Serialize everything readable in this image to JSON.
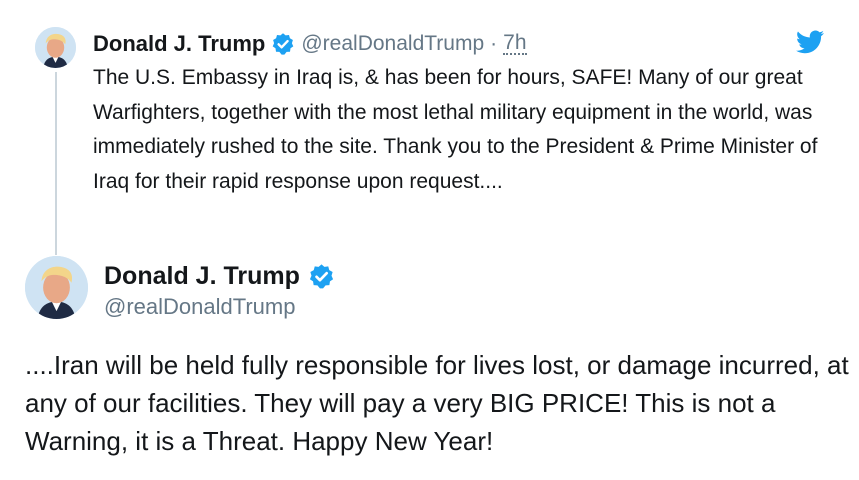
{
  "tweets": [
    {
      "author_name": "Donald J. Trump",
      "handle": "@realDonaldTrump",
      "separator": "·",
      "time": "7h",
      "text": "The U.S. Embassy in Iraq is, & has been for hours, SAFE! Many of our great Warfighters, together with the most lethal military equipment in the world, was immediately rushed to the site. Thank you to the President & Prime Minister of Iraq for their rapid response upon request...."
    },
    {
      "author_name": "Donald J. Trump",
      "handle": "@realDonaldTrump",
      "text": "....Iran will be held fully responsible for lives lost, or damage incurred, at any of our facilities. They will pay a very BIG PRICE! This is not a Warning, it is a Threat. Happy New Year!"
    }
  ],
  "icons": {
    "verified": "verified-badge-icon",
    "bird": "twitter-bird-icon"
  },
  "colors": {
    "verified": "#1da1f2",
    "bird": "#1da1f2",
    "muted_text": "#657786",
    "main_text": "#14171a",
    "thread_line": "#ccd6dd"
  }
}
